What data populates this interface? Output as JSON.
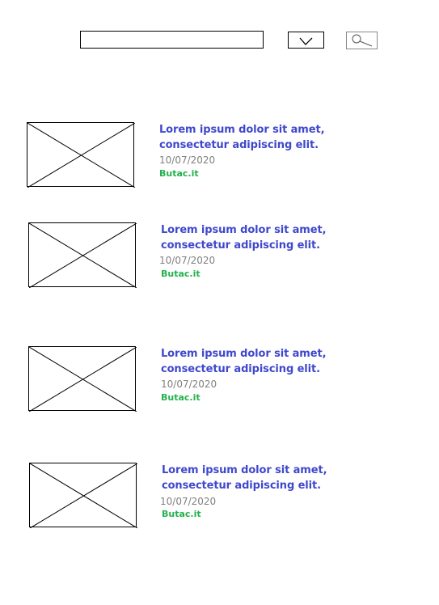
{
  "search": {
    "value": "",
    "placeholder": "",
    "icon": "magnifier-icon"
  },
  "filter": {
    "selected": "",
    "icon": "chevron-down-icon"
  },
  "results": [
    {
      "title": "Lorem ipsum dolor sit amet, consectetur adipiscing elit.",
      "date": "10/07/2020",
      "source": "Butac.it",
      "thumbnail": "image-placeholder-icon"
    },
    {
      "title": "Lorem ipsum dolor sit amet, consectetur adipiscing elit.",
      "date": "10/07/2020",
      "source": "Butac.it",
      "thumbnail": "image-placeholder-icon"
    },
    {
      "title": "Lorem ipsum dolor sit amet, consectetur adipiscing elit.",
      "date": "10/07/2020",
      "source": "Butac.it",
      "thumbnail": "image-placeholder-icon"
    },
    {
      "title": "Lorem ipsum dolor sit amet, consectetur adipiscing elit.",
      "date": "10/07/2020",
      "source": "Butac.it",
      "thumbnail": "image-placeholder-icon"
    }
  ],
  "colors": {
    "title": "#3f48cc",
    "date": "#808080",
    "source": "#22b14c",
    "border": "#000000"
  }
}
